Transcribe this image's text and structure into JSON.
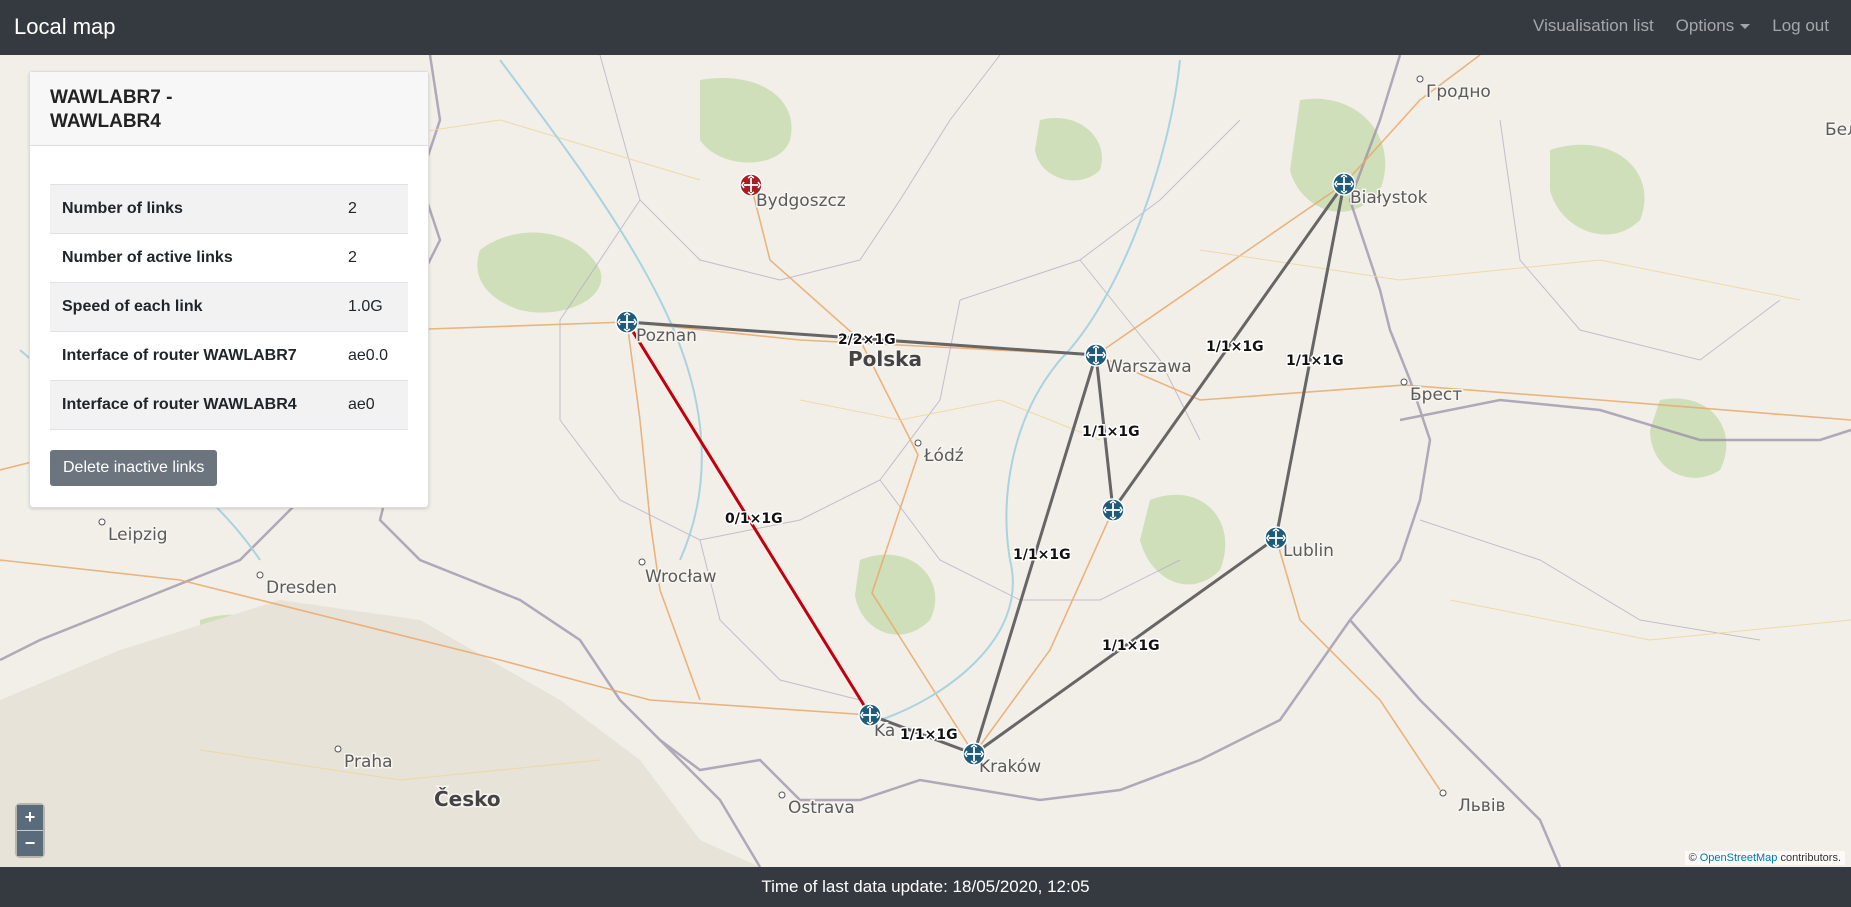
{
  "app": {
    "title": "Local map"
  },
  "nav": {
    "visualisation_list": "Visualisation list",
    "options": "Options",
    "logout": "Log out"
  },
  "panel": {
    "title": "WAWLABR7 - WAWLABR4",
    "rows": [
      {
        "key": "Number of links",
        "value": "2"
      },
      {
        "key": "Number of active links",
        "value": "2"
      },
      {
        "key": "Speed of each link",
        "value": "1.0G"
      },
      {
        "key": "Interface of router WAWLABR7",
        "value": "ae0.0"
      },
      {
        "key": "Interface of router WAWLABR4",
        "value": "ae0"
      }
    ],
    "delete_button": "Delete inactive links"
  },
  "map": {
    "cities": {
      "bydgoszcz": "Bydgoszcz",
      "poznan": "Poznan",
      "polska": "Polska",
      "warszawa": "Warszawa",
      "bialystok": "Białystok",
      "grodno": "Гродно",
      "brest": "Брест",
      "lodz": "Łódź",
      "lublin": "Lublin",
      "wroclaw": "Wrocław",
      "leipzig": "Leipzig",
      "dresden": "Dresden",
      "praha": "Praha",
      "cesko": "Česko",
      "ostrava": "Ostrava",
      "krakow": "Kraków",
      "katowice": "Ka",
      "lviv": "Львів",
      "bela": "Бел"
    },
    "links": {
      "poznan_warszawa": "2/2×1G",
      "poznan_katowice": "0/1×1G",
      "warszawa_radom": "1/1×1G",
      "warszawa_krakow": "1/1×1G",
      "radom_bialystok": "1/1×1G",
      "bialystok_lublin": "1/1×1G",
      "lublin_krakow": "1/1×1G",
      "katowice_krakow": "1/1×1G"
    },
    "colors": {
      "active_link": "#666666",
      "inactive_link": "#c0000f",
      "router": "#1e5a7a",
      "router_down": "#a81c22"
    },
    "zoom_in": "+",
    "zoom_out": "−",
    "attribution_prefix": "©",
    "attribution_link": "OpenStreetMap",
    "attribution_suffix": "contributors."
  },
  "footer": {
    "text": "Time of last data update: 18/05/2020, 12:05"
  }
}
